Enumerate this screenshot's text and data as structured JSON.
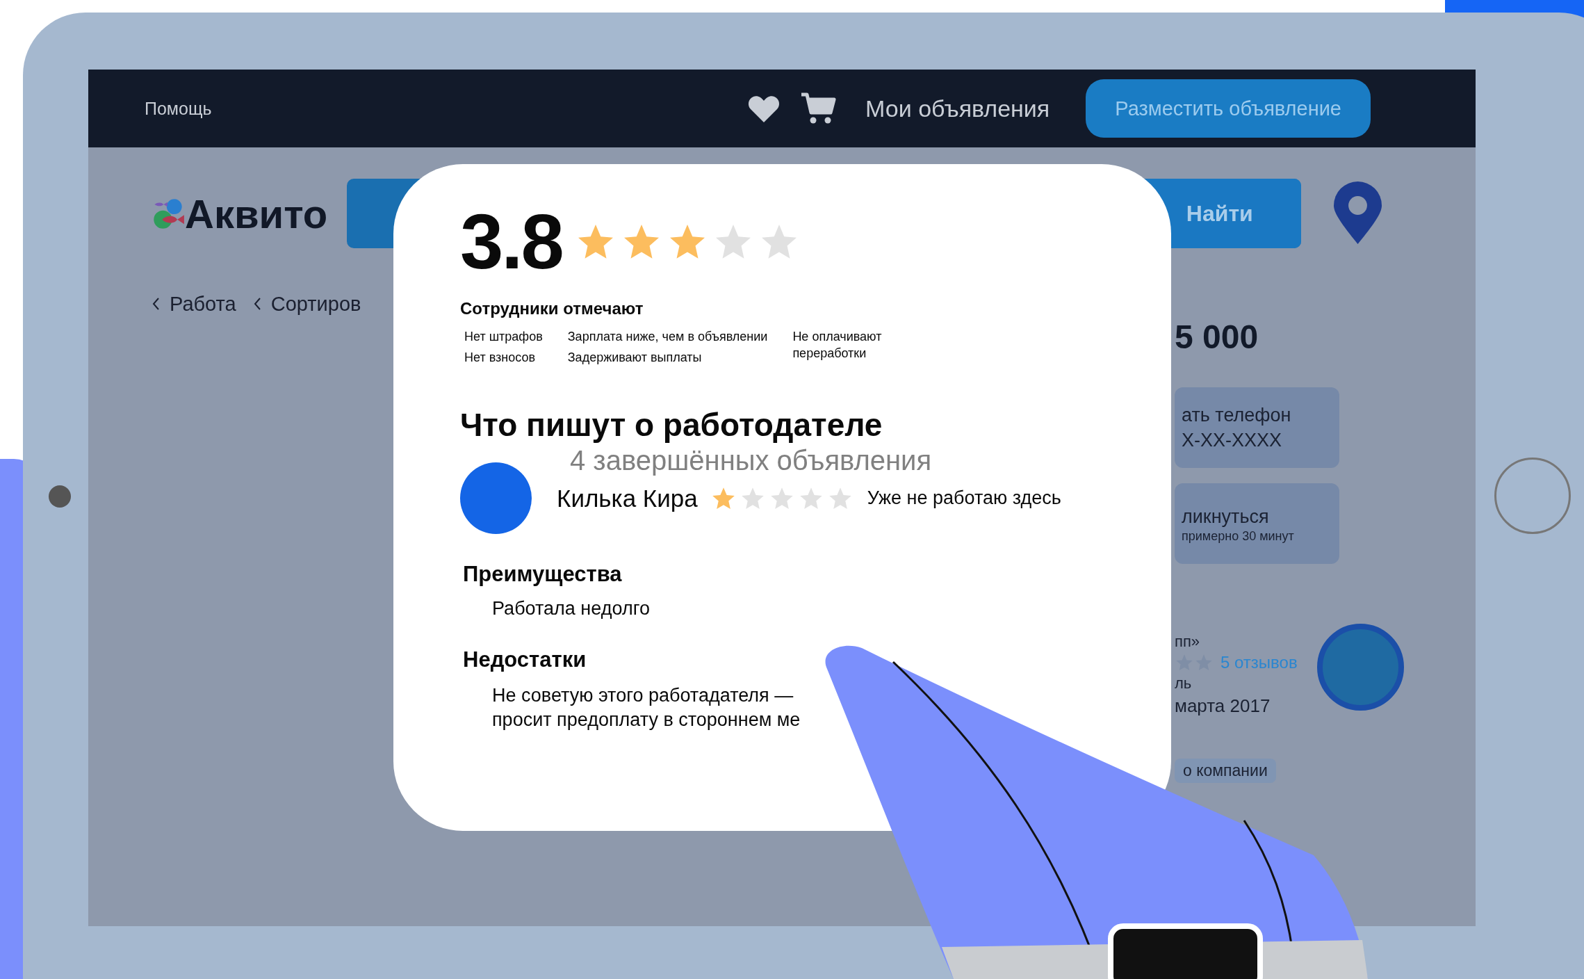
{
  "top_bar": {
    "help_link": "Помощь",
    "my_ads_link": "Мои объявления",
    "post_ad_button": "Разместить объявление"
  },
  "header": {
    "logo": "Аквито",
    "search_button": "Найти"
  },
  "breadcrumbs": [
    {
      "label": "Работа"
    },
    {
      "label": "Сортиров"
    }
  ],
  "listing": {
    "salary": "5 000",
    "phone_card": {
      "title": "ать телефон",
      "value": "X-XX-XXXX"
    },
    "respond_card": {
      "title": "ликнуться",
      "subtitle": "примерно 30 минут"
    },
    "employer": {
      "name": "пп»",
      "reviews_link": "5 отзывов",
      "role": "ль",
      "since": "марта 2017"
    },
    "about_tag": "о компании"
  },
  "review_popup": {
    "rating": "3.8",
    "stars": 3,
    "employees_note_title": "Сотрудники отмечают",
    "employee_tag_columns": [
      {
        "items": [
          "Нет штрафов",
          "Нет взносов"
        ]
      },
      {
        "items": [
          "Зарплата ниже, чем в объявлении",
          "Задерживают выплаты"
        ]
      },
      {
        "items": [
          "Не оплачивают переработки"
        ]
      }
    ],
    "section_title": "Что пишут о работодателе",
    "completed_ads": "4 завершённых объявления",
    "review": {
      "author": "Килька Кира",
      "stars": 1,
      "status": "Уже не работаю здесь",
      "pros_title": "Преимущества",
      "pros": "Работала недолго",
      "cons_title": "Недостатки",
      "cons_lines": [
        "Не советую этого работадателя —",
        "просит предоплату в стороннем ме"
      ]
    }
  }
}
